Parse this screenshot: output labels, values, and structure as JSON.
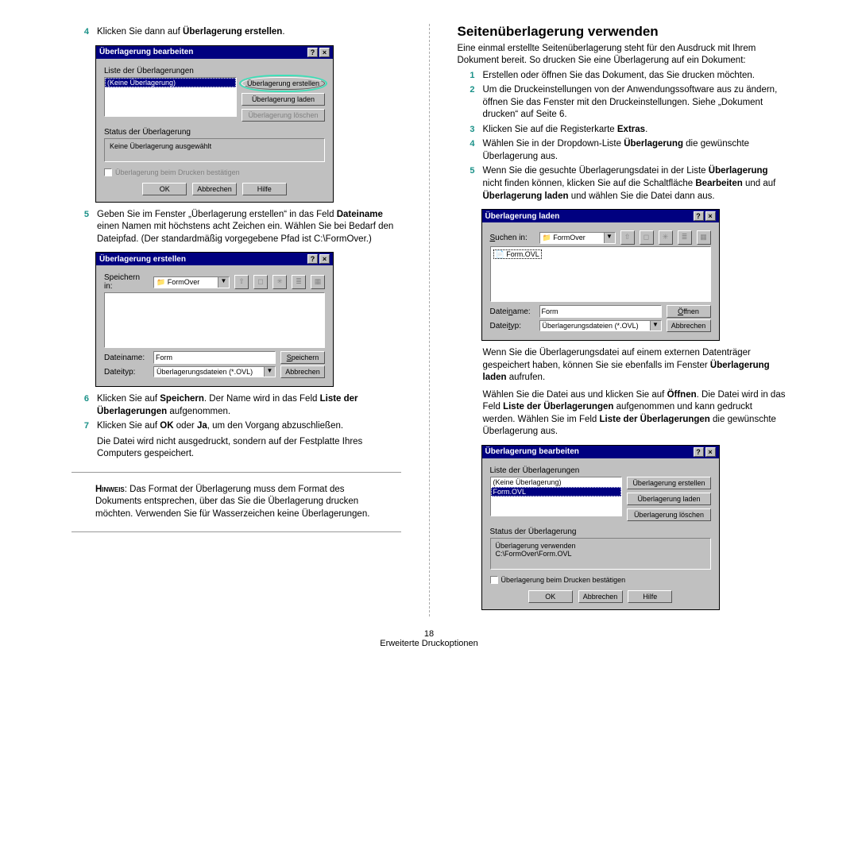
{
  "page_number": "18",
  "footer": "Erweiterte Druckoptionen",
  "left": {
    "step4_num": "4",
    "step4_a": "Klicken Sie dann auf ",
    "step4_b": "Überlagerung erstellen",
    "step4_c": ".",
    "dlg1": {
      "title": "Überlagerung bearbeiten",
      "list_label": "Liste der Überlagerungen",
      "item": "(Keine Überlagerung)",
      "btn_create": "Überlagerung erstellen",
      "btn_load": "Überlagerung laden",
      "btn_delete": "Überlagerung löschen",
      "status_label": "Status der Überlagerung",
      "status_text": "Keine Überlagerung ausgewählt",
      "confirm": "Überlagerung beim Drucken bestätigen",
      "ok": "OK",
      "cancel": "Abbrechen",
      "help": "Hilfe"
    },
    "step5_num": "5",
    "step5_a": "Geben Sie im Fenster „Überlagerung erstellen“ in das Feld ",
    "step5_b": "Dateiname",
    "step5_c": " einen Namen mit höchstens acht Zeichen ein. Wählen Sie bei Bedarf den Dateipfad. (Der standardmäßig vorgegebene Pfad ist C:\\FormOver.)",
    "dlg2": {
      "title": "Überlagerung erstellen",
      "savein": "Speichern in:",
      "folder": "FormOver",
      "fname_label": "Dateiname:",
      "fname": "Form",
      "ftype_label": "Dateityp:",
      "ftype": "Überlagerungsdateien (*.OVL)",
      "save": "Speichern",
      "cancel": "Abbrechen"
    },
    "step6_num": "6",
    "step6_a": "Klicken Sie auf ",
    "step6_b": "Speichern",
    "step6_c": ". Der Name wird in das Feld ",
    "step6_d": "Liste der Überlagerungen",
    "step6_e": " aufgenommen.",
    "step7_num": "7",
    "step7_a": "Klicken Sie auf ",
    "step7_b": "OK",
    "step7_c": " oder ",
    "step7_d": "Ja",
    "step7_e": ", um den Vorgang abzuschließen.",
    "step7_f": "Die Datei wird nicht ausgedruckt, sondern auf der Festplatte Ihres Computers gespeichert.",
    "hinweis_label": "Hinweis",
    "hinweis": ": Das Format der Überlagerung muss dem Format des Dokuments entsprechen, über das Sie die Überlagerung drucken möchten. Verwenden Sie für Wasserzeichen keine Überlagerungen."
  },
  "right": {
    "h2": "Seitenüberlagerung verwenden",
    "intro": "Eine einmal erstellte Seitenüberlagerung steht für den Ausdruck mit Ihrem Dokument bereit. So drucken Sie eine Überlagerung auf ein Dokument:",
    "step1_num": "1",
    "step1": "Erstellen oder öffnen Sie das Dokument, das Sie drucken möchten.",
    "step2_num": "2",
    "step2": "Um die Druckeinstellungen von der Anwendungssoftware aus zu ändern, öffnen Sie das Fenster mit den Druckeinstellungen. Siehe „Dokument drucken“ auf Seite 6.",
    "step3_num": "3",
    "step3_a": "Klicken Sie auf die Registerkarte ",
    "step3_b": "Extras",
    "step3_c": ".",
    "step4_num": "4",
    "step4_a": "Wählen Sie in der Dropdown-Liste ",
    "step4_b": "Überlagerung",
    "step4_c": " die gewünschte Überlagerung aus.",
    "step5_num": "5",
    "step5_a": "Wenn Sie die gesuchte Überlagerungsdatei in der Liste ",
    "step5_b": "Überlagerung",
    "step5_c": " nicht finden können, klicken Sie auf die Schaltfläche ",
    "step5_d": "Bearbeiten",
    "step5_e": " und auf ",
    "step5_f": "Überlagerung laden",
    "step5_g": " und wählen Sie die Datei dann aus.",
    "dlg3": {
      "title": "Überlagerung laden",
      "lookin": "Suchen in:",
      "folder": "FormOver",
      "file": "Form.OVL",
      "fname_label": "Dateiname:",
      "fname": "Form",
      "ftype_label": "Dateityp:",
      "ftype": "Überlagerungsdateien (*.OVL)",
      "open": "Öffnen",
      "cancel": "Abbrechen"
    },
    "para_a": "Wenn Sie die Überlagerungsdatei auf einem externen Datenträger gespeichert haben, können Sie sie ebenfalls im Fenster ",
    "para_b": "Überlagerung laden",
    "para_c": " aufrufen.",
    "para2_a": "Wählen Sie die Datei aus und klicken Sie auf ",
    "para2_b": "Öffnen",
    "para2_c": ". Die Datei wird in das Feld ",
    "para2_d": "Liste der Überlagerungen",
    "para2_e": " aufgenommen und kann gedruckt werden. Wählen Sie im Feld ",
    "para2_f": "Liste der Überlagerungen",
    "para2_g": " die gewünschte Überlagerung aus.",
    "dlg4": {
      "title": "Überlagerung bearbeiten",
      "list_label": "Liste der Überlagerungen",
      "item1": "(Keine Überlagerung)",
      "item2": "Form.OVL",
      "btn_create": "Überlagerung erstellen",
      "btn_load": "Überlagerung laden",
      "btn_delete": "Überlagerung löschen",
      "status_label": "Status der Überlagerung",
      "status_text1": "Überlagerung verwenden",
      "status_text2": "C:\\FormOver\\Form.OVL",
      "confirm": "Überlagerung beim Drucken bestätigen",
      "ok": "OK",
      "cancel": "Abbrechen",
      "help": "Hilfe"
    }
  }
}
